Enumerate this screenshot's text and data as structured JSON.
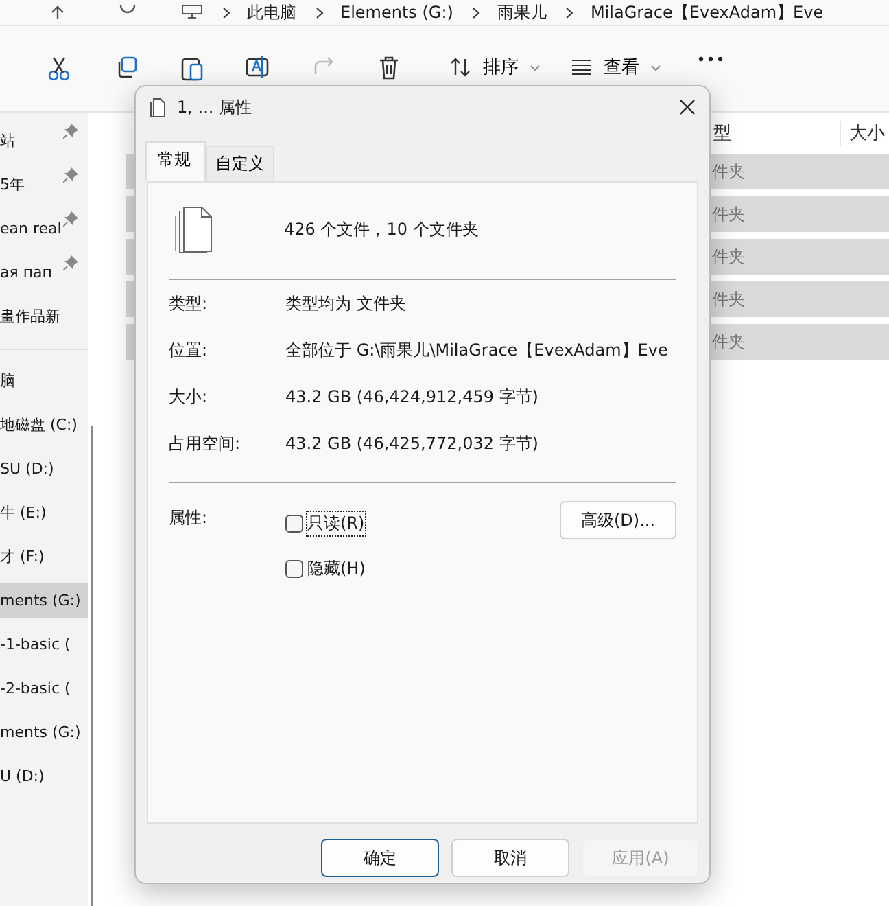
{
  "address_bar": {
    "breadcrumbs": [
      "此电脑",
      "Elements (G:)",
      "雨果儿",
      "MilaGrace【EvexAdam】Eve"
    ]
  },
  "toolbar": {
    "sort": "排序",
    "view": "查看"
  },
  "sidebar": {
    "pinned": [
      "站",
      "5年",
      "ean real",
      "ая пап",
      "畫作品新"
    ],
    "drives": [
      {
        "label": "脑",
        "selected": false
      },
      {
        "label": "地磁盘 (C:)",
        "selected": false
      },
      {
        "label": "SU (D:)",
        "selected": false
      },
      {
        "label": "牛 (E:)",
        "selected": false
      },
      {
        "label": "才 (F:)",
        "selected": false
      },
      {
        "label": "ments (G:)",
        "selected": true
      },
      {
        "label": "-1-basic (",
        "selected": false
      },
      {
        "label": "-2-basic (",
        "selected": false
      },
      {
        "label": "ments (G:)",
        "selected": false
      },
      {
        "label": "U (D:)",
        "selected": false
      }
    ]
  },
  "file_list": {
    "columns": [
      "型",
      "大小"
    ],
    "rows": [
      {
        "type": "件夹",
        "selected": true
      },
      {
        "type": "件夹",
        "selected": true
      },
      {
        "type": "件夹",
        "selected": true
      },
      {
        "type": "件夹",
        "selected": true
      },
      {
        "type": "件夹",
        "selected": true
      }
    ]
  },
  "dialog": {
    "title": "1, ... 属性",
    "tabs": [
      {
        "label": "常规",
        "selected": true
      },
      {
        "label": "自定义",
        "selected": false
      }
    ],
    "summary": "426 个文件，10 个文件夹",
    "details": [
      {
        "label": "类型:",
        "value": "类型均为 文件夹"
      },
      {
        "label": "位置:",
        "value": "全部位于 G:\\雨果儿\\MilaGrace【EvexAdam】Eve"
      },
      {
        "label": "大小:",
        "value": "43.2 GB (46,424,912,459 字节)"
      },
      {
        "label": "占用空间:",
        "value": "43.2 GB (46,425,772,032 字节)"
      }
    ],
    "attributes": {
      "label": "属性:",
      "options": [
        {
          "label": "只读(R)",
          "checked": false,
          "focused": true
        },
        {
          "label": "隐藏(H)",
          "checked": false,
          "focused": false
        }
      ]
    },
    "advanced_button": "高级(D)...",
    "buttons": [
      {
        "label": "确定",
        "kind": "default"
      },
      {
        "label": "取消",
        "kind": "normal"
      },
      {
        "label": "应用(A)",
        "kind": "disabled"
      }
    ]
  }
}
